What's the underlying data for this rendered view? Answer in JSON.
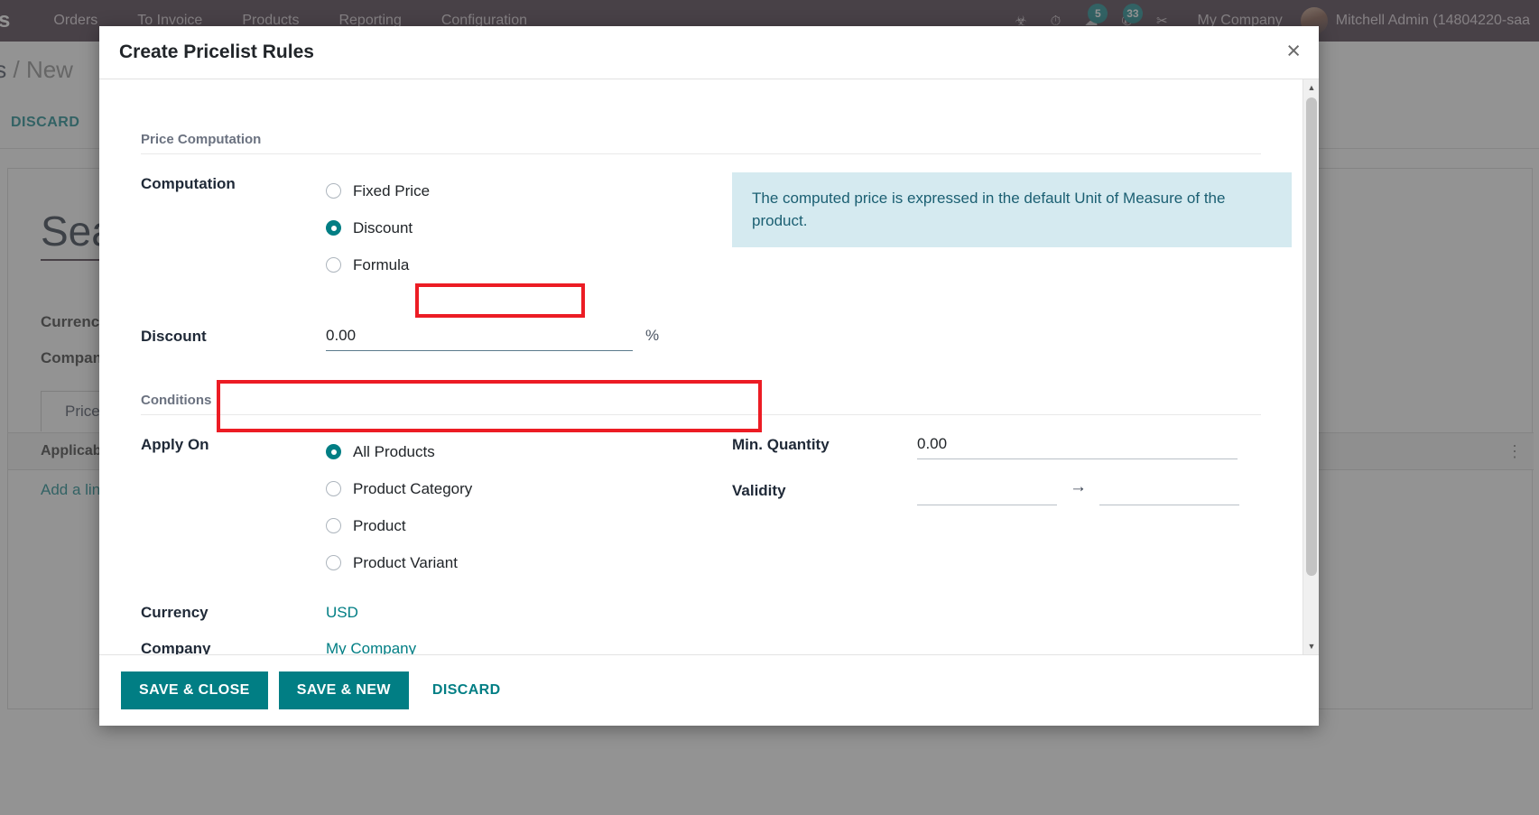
{
  "navbar": {
    "brand": "les",
    "items": [
      {
        "label": "Orders"
      },
      {
        "label": "To Invoice"
      },
      {
        "label": "Products"
      },
      {
        "label": "Reporting"
      },
      {
        "label": "Configuration"
      }
    ],
    "icons": [
      {
        "name": "bug-icon",
        "glyph": "☣"
      },
      {
        "name": "clock-icon",
        "glyph": "⏱"
      },
      {
        "name": "messages-icon",
        "glyph": "☁",
        "badge": "5"
      },
      {
        "name": "activities-icon",
        "glyph": "✆",
        "badge": "33"
      },
      {
        "name": "scissors-icon",
        "glyph": "✂"
      }
    ],
    "company": "My Company",
    "user": "Mitchell Admin (14804220-saa"
  },
  "background": {
    "breadcrumb_prefix": "sts",
    "breadcrumb_sep": "/",
    "breadcrumb_current": "New",
    "discard_label": "DISCARD",
    "record_title": "Sea",
    "currency_label": "Currency",
    "company_label": "Company",
    "tab_label": "Price",
    "applicable_label": "Applicab",
    "add_line_label": "Add a lin",
    "dots": "⋮"
  },
  "modal": {
    "title": "Create Pricelist Rules",
    "close_icon": "×",
    "price_computation": {
      "section_title": "Price Computation",
      "computation_label": "Computation",
      "options": [
        {
          "label": "Fixed Price",
          "checked": false
        },
        {
          "label": "Discount",
          "checked": true
        },
        {
          "label": "Formula",
          "checked": false
        }
      ],
      "alert_text": "The computed price is expressed in the default Unit of Measure of the product.",
      "discount_label": "Discount",
      "discount_value": "0.00",
      "discount_unit": "%"
    },
    "conditions": {
      "section_title": "Conditions",
      "apply_on_label": "Apply On",
      "apply_on_options": [
        {
          "label": "All Products",
          "checked": true
        },
        {
          "label": "Product Category",
          "checked": false
        },
        {
          "label": "Product",
          "checked": false
        },
        {
          "label": "Product Variant",
          "checked": false
        }
      ],
      "min_quantity_label": "Min. Quantity",
      "min_quantity_value": "0.00",
      "validity_label": "Validity",
      "validity_from": "",
      "validity_to": "",
      "validity_placeholder": "",
      "validity_arrow": "→",
      "currency_label": "Currency",
      "currency_value": "USD",
      "company_label": "Company",
      "company_value": "My Company"
    },
    "footer": {
      "save_close_label": "SAVE & CLOSE",
      "save_new_label": "SAVE & NEW",
      "discard_label": "DISCARD"
    },
    "scrollbar": {
      "up_glyph": "▲",
      "down_glyph": "▼"
    }
  },
  "colors": {
    "brand_teal": "#017e84",
    "navbar_bg": "#3c2837",
    "alert_bg": "#d5eaf0",
    "highlight_red": "#ec1c24"
  }
}
